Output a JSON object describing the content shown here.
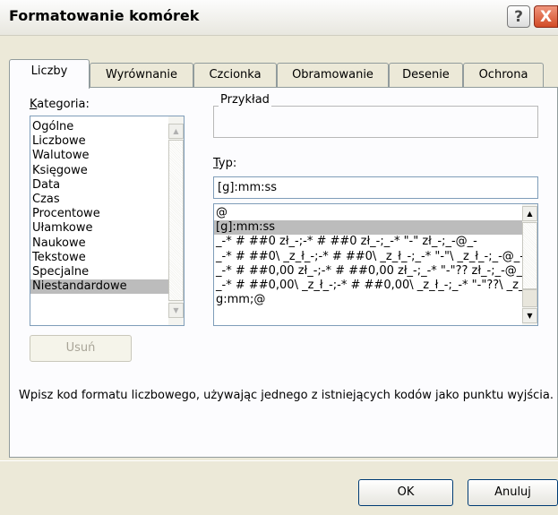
{
  "window": {
    "title": "Formatowanie komórek",
    "help": "?",
    "close": "X"
  },
  "tabs": [
    "Liczby",
    "Wyrównanie",
    "Czcionka",
    "Obramowanie",
    "Desenie",
    "Ochrona"
  ],
  "category": {
    "label": "Kategoria:",
    "items": [
      "Ogólne",
      "Liczbowe",
      "Walutowe",
      "Księgowe",
      "Data",
      "Czas",
      "Procentowe",
      "Ułamkowe",
      "Naukowe",
      "Tekstowe",
      "Specjalne",
      "Niestandardowe"
    ],
    "selected": "Niestandardowe"
  },
  "sample": {
    "legend": "Przykład",
    "value": ""
  },
  "type": {
    "label": "Typ:",
    "value": "[g]:mm:ss",
    "list": [
      "@",
      "[g]:mm:ss",
      "_-* # ##0 zł_-;-* # ##0 zł_-;_-* \"-\" zł_-;_-@_-",
      "_-* # ##0\\ _z_ł_-;-* # ##0\\ _z_ł_-;_-* \"-\"\\ _z_ł_-;_-@_-",
      "_-* # ##0,00 zł_-;-* # ##0,00 zł_-;_-* \"-\"?? zł_-;_-@_-",
      "_-* # ##0,00\\ _z_ł_-;-* # ##0,00\\ _z_ł_-;_-* \"-\"??\\ _z_ł_-;_-@_-",
      "g:mm;@"
    ],
    "selected": "[g]:mm:ss"
  },
  "buttons": {
    "delete": "Usuń",
    "ok": "OK",
    "cancel": "Anuluj"
  },
  "hint": "Wpisz kod formatu liczbowego, używając jednego z istniejących kodów jako punktu wyjścia."
}
